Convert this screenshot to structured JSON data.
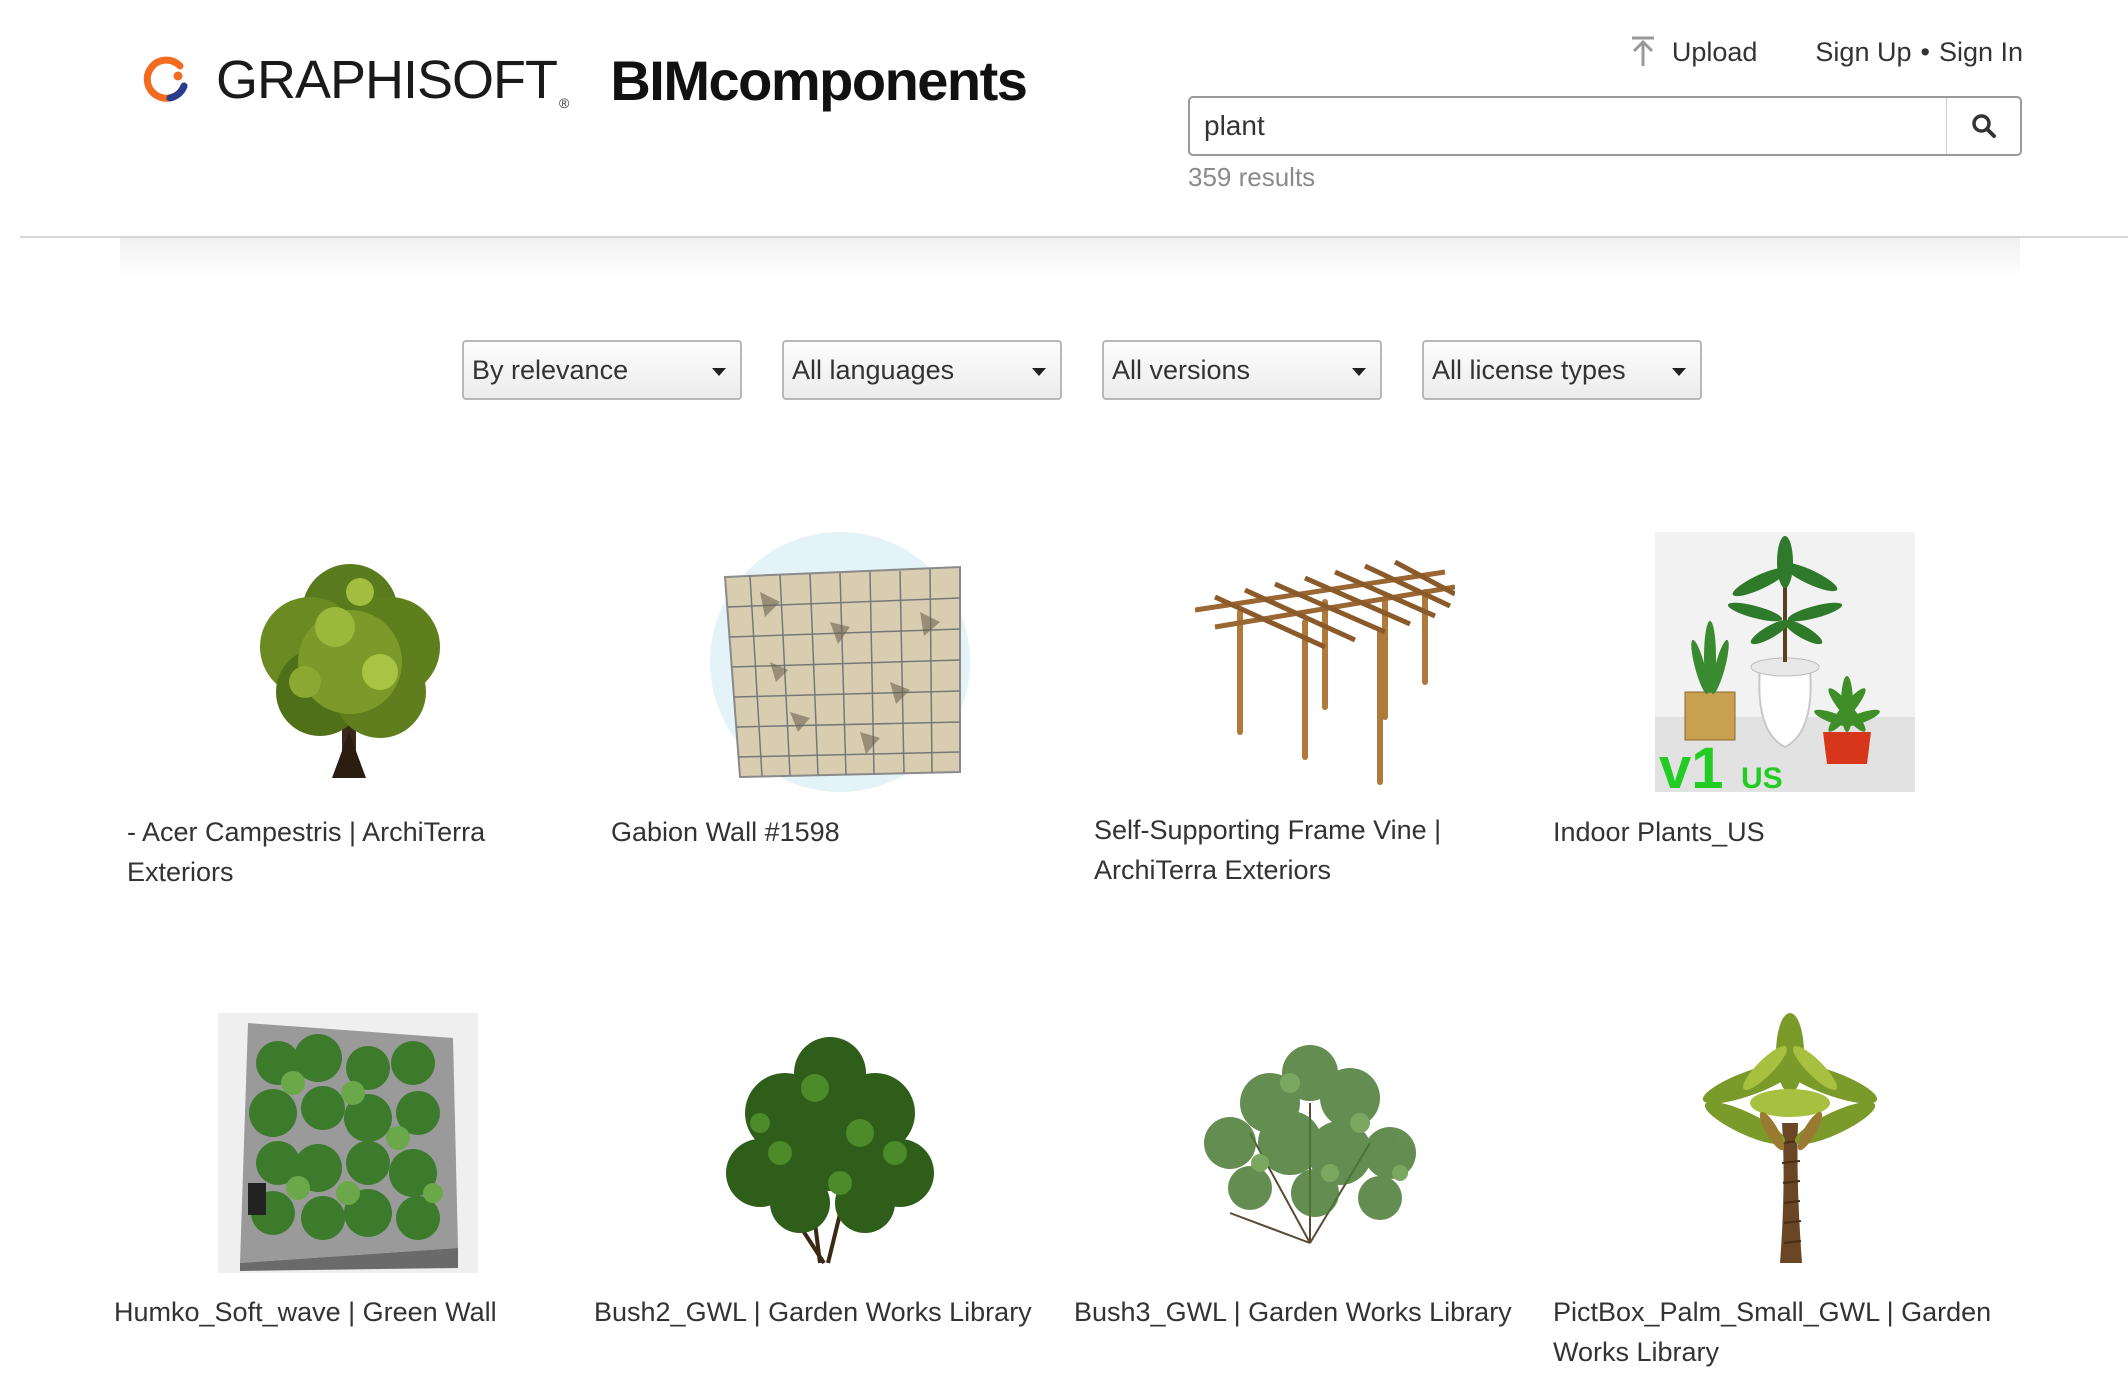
{
  "header": {
    "brand": "GRAPHISOFT",
    "brand_reg": "®",
    "product": "BIMcomponents",
    "upload_label": "Upload",
    "sign_up": "Sign Up",
    "separator": "•",
    "sign_in": "Sign In"
  },
  "search": {
    "value": "plant",
    "results_text": "359 results"
  },
  "filters": [
    {
      "selected": "By relevance"
    },
    {
      "selected": "All languages"
    },
    {
      "selected": "All versions"
    },
    {
      "selected": "All license types"
    }
  ],
  "items": [
    {
      "title": "- Acer Campestris | ArchiTerra Exteriors",
      "icon": "tree-thumbnail"
    },
    {
      "title": "Gabion Wall #1598",
      "icon": "gabion-wall-thumbnail"
    },
    {
      "title": "Self-Supporting Frame Vine | ArchiTerra Exteriors",
      "icon": "pergola-thumbnail"
    },
    {
      "title": "Indoor Plants_US",
      "icon": "indoor-plants-thumbnail",
      "badge_version": "v1",
      "badge_region": "US"
    },
    {
      "title": "Humko_Soft_wave | Green Wall",
      "icon": "green-wall-thumbnail"
    },
    {
      "title": "Bush2_GWL | Garden Works Library",
      "icon": "bush-thumbnail"
    },
    {
      "title": "Bush3_GWL | Garden Works Library",
      "icon": "bush-thumbnail"
    },
    {
      "title": "PictBox_Palm_Small_GWL | Garden Works Library",
      "icon": "palm-thumbnail"
    }
  ],
  "colors": {
    "logo_orange": "#f26b21",
    "logo_blue": "#2a3b8f",
    "badge_green": "#22cc22"
  }
}
